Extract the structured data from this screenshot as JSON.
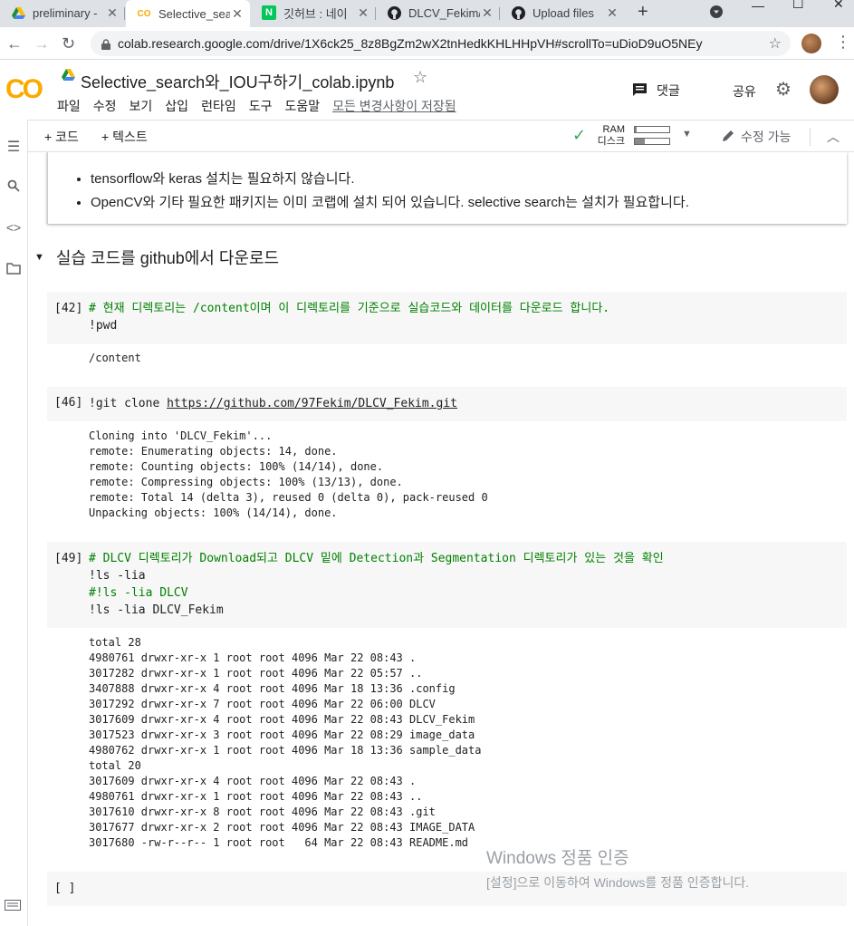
{
  "browser": {
    "tabs": [
      {
        "label": "preliminary -",
        "icon": "drive-icon"
      },
      {
        "label": "Selective_sear",
        "icon": "colab-icon",
        "active": true
      },
      {
        "label": "깃허브 : 네이",
        "icon": "naver-icon"
      },
      {
        "label": "DLCV_Fekim/",
        "icon": "github-icon"
      },
      {
        "label": "Upload files",
        "icon": "github-icon"
      }
    ],
    "new_tab": "+",
    "url": "colab.research.google.com/drive/1X6ck25_8z8BgZm2wX2tnHedkKHLHHpVH#scrollTo=uDioD9uO5NEy"
  },
  "colab": {
    "logo": "CO",
    "title": "Selective_search와_IOU구하기_colab.ipynb",
    "menus": [
      "파일",
      "수정",
      "보기",
      "삽입",
      "런타임",
      "도구",
      "도움말"
    ],
    "saved_status": "모든 변경사항이 저장됨",
    "comment_label": "댓글",
    "share_label": "공유"
  },
  "toolbar": {
    "add_code": "+ 코드",
    "add_text": "+ 텍스트",
    "ram_label": "RAM",
    "disk_label": "디스크",
    "ram_usage": 0.05,
    "disk_usage": 0.3,
    "edit_mode": "수정 가능"
  },
  "text_cell": {
    "bullets": [
      "tensorflow와 keras 설치는 필요하지 않습니다.",
      "OpenCV와 기타 필요한 패키지는 이미 코랩에 설치 되어 있습니다. selective search는 설치가 필요합니다."
    ]
  },
  "section_title": "실습 코드를 github에서 다운로드",
  "cells": {
    "c42": {
      "num": "[42]",
      "line1": "# 현재 디렉토리는 /content이며 이 디렉토리를 기준으로 실습코드와 데이터를 다운로드 합니다.",
      "line2": "!pwd",
      "output": "/content"
    },
    "c46": {
      "num": "[46]",
      "prefix": "!git clone ",
      "link": "https://github.com/97Fekim/DLCV_Fekim.git",
      "output": "Cloning into 'DLCV_Fekim'...\nremote: Enumerating objects: 14, done.\nremote: Counting objects: 100% (14/14), done.\nremote: Compressing objects: 100% (13/13), done.\nremote: Total 14 (delta 3), reused 0 (delta 0), pack-reused 0\nUnpacking objects: 100% (14/14), done."
    },
    "c49": {
      "num": "[49]",
      "line1": "# DLCV 디렉토리가 Download되고 DLCV 밑에 Detection과 Segmentation 디렉토리가 있는 것을 확인",
      "line2": "!ls -lia",
      "line3": "#!ls -lia DLCV",
      "line4": "!ls -lia DLCV_Fekim",
      "output": "total 28\n4980761 drwxr-xr-x 1 root root 4096 Mar 22 08:43 .\n3017282 drwxr-xr-x 1 root root 4096 Mar 22 05:57 ..\n3407888 drwxr-xr-x 4 root root 4096 Mar 18 13:36 .config\n3017292 drwxr-xr-x 7 root root 4096 Mar 22 06:00 DLCV\n3017609 drwxr-xr-x 4 root root 4096 Mar 22 08:43 DLCV_Fekim\n3017523 drwxr-xr-x 3 root root 4096 Mar 22 08:29 image_data\n4980762 drwxr-xr-x 1 root root 4096 Mar 18 13:36 sample_data\ntotal 20\n3017609 drwxr-xr-x 4 root root 4096 Mar 22 08:43 .\n4980761 drwxr-xr-x 1 root root 4096 Mar 22 08:43 ..\n3017610 drwxr-xr-x 8 root root 4096 Mar 22 08:43 .git\n3017677 drwxr-xr-x 2 root root 4096 Mar 22 08:43 IMAGE_DATA\n3017680 -rw-r--r-- 1 root root   64 Mar 22 08:43 README.md"
    },
    "empty": {
      "num": "[ ]"
    }
  },
  "watermark": {
    "line1": "Windows 정품 인증",
    "line2": "[설정]으로 이동하여 Windows를 정품 인증합니다."
  }
}
